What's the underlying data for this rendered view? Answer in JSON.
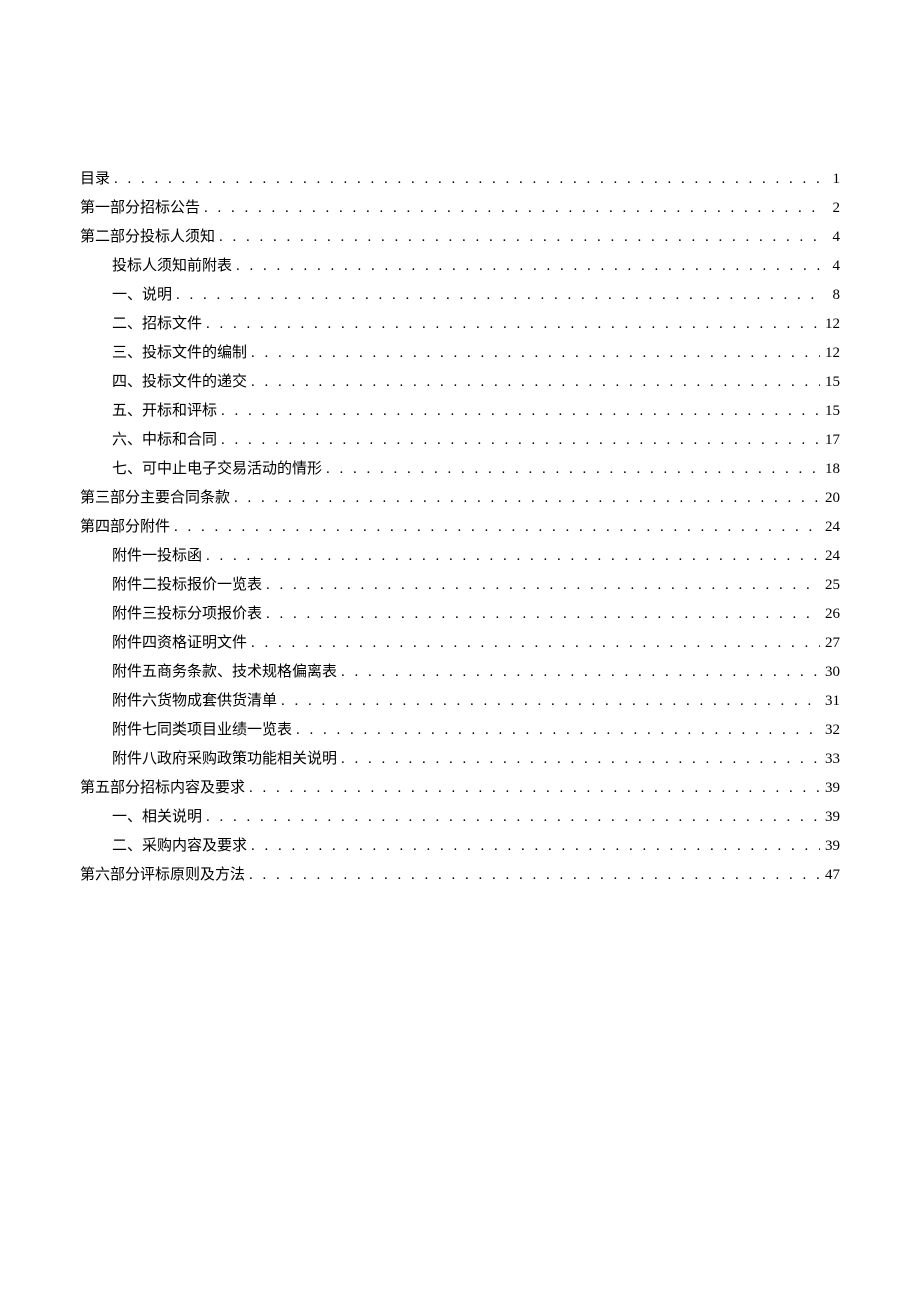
{
  "toc": [
    {
      "level": 0,
      "title": "目录",
      "page": "1"
    },
    {
      "level": 0,
      "title": "第一部分招标公告",
      "page": "2"
    },
    {
      "level": 0,
      "title": "第二部分投标人须知",
      "page": "4"
    },
    {
      "level": 1,
      "title": "投标人须知前附表",
      "page": "4"
    },
    {
      "level": 1,
      "title": "一、说明",
      "page": "8"
    },
    {
      "level": 1,
      "title": "二、招标文件",
      "page": "12"
    },
    {
      "level": 1,
      "title": "三、投标文件的编制",
      "page": "12"
    },
    {
      "level": 1,
      "title": "四、投标文件的递交",
      "page": "15"
    },
    {
      "level": 1,
      "title": "五、开标和评标",
      "page": "15"
    },
    {
      "level": 1,
      "title": "六、中标和合同",
      "page": "17"
    },
    {
      "level": 1,
      "title": "七、可中止电子交易活动的情形",
      "page": "18"
    },
    {
      "level": 0,
      "title": "第三部分主要合同条款",
      "page": "20"
    },
    {
      "level": 0,
      "title": "第四部分附件",
      "page": "24"
    },
    {
      "level": 1,
      "title": "附件一投标函",
      "page": "24"
    },
    {
      "level": 1,
      "title": "附件二投标报价一览表",
      "page": "25"
    },
    {
      "level": 1,
      "title": "附件三投标分项报价表",
      "page": "26"
    },
    {
      "level": 1,
      "title": "附件四资格证明文件",
      "page": "27"
    },
    {
      "level": 1,
      "title": "附件五商务条款、技术规格偏离表",
      "page": "30"
    },
    {
      "level": 1,
      "title": "附件六货物成套供货清单",
      "page": "31"
    },
    {
      "level": 1,
      "title": "附件七同类项目业绩一览表",
      "page": "32"
    },
    {
      "level": 1,
      "title": "附件八政府采购政策功能相关说明",
      "page": "33"
    },
    {
      "level": 0,
      "title": "第五部分招标内容及要求",
      "page": "39"
    },
    {
      "level": 1,
      "title": "一、相关说明",
      "page": "39"
    },
    {
      "level": 1,
      "title": "二、采购内容及要求",
      "page": "39"
    },
    {
      "level": 0,
      "title": "第六部分评标原则及方法",
      "page": "47"
    }
  ]
}
